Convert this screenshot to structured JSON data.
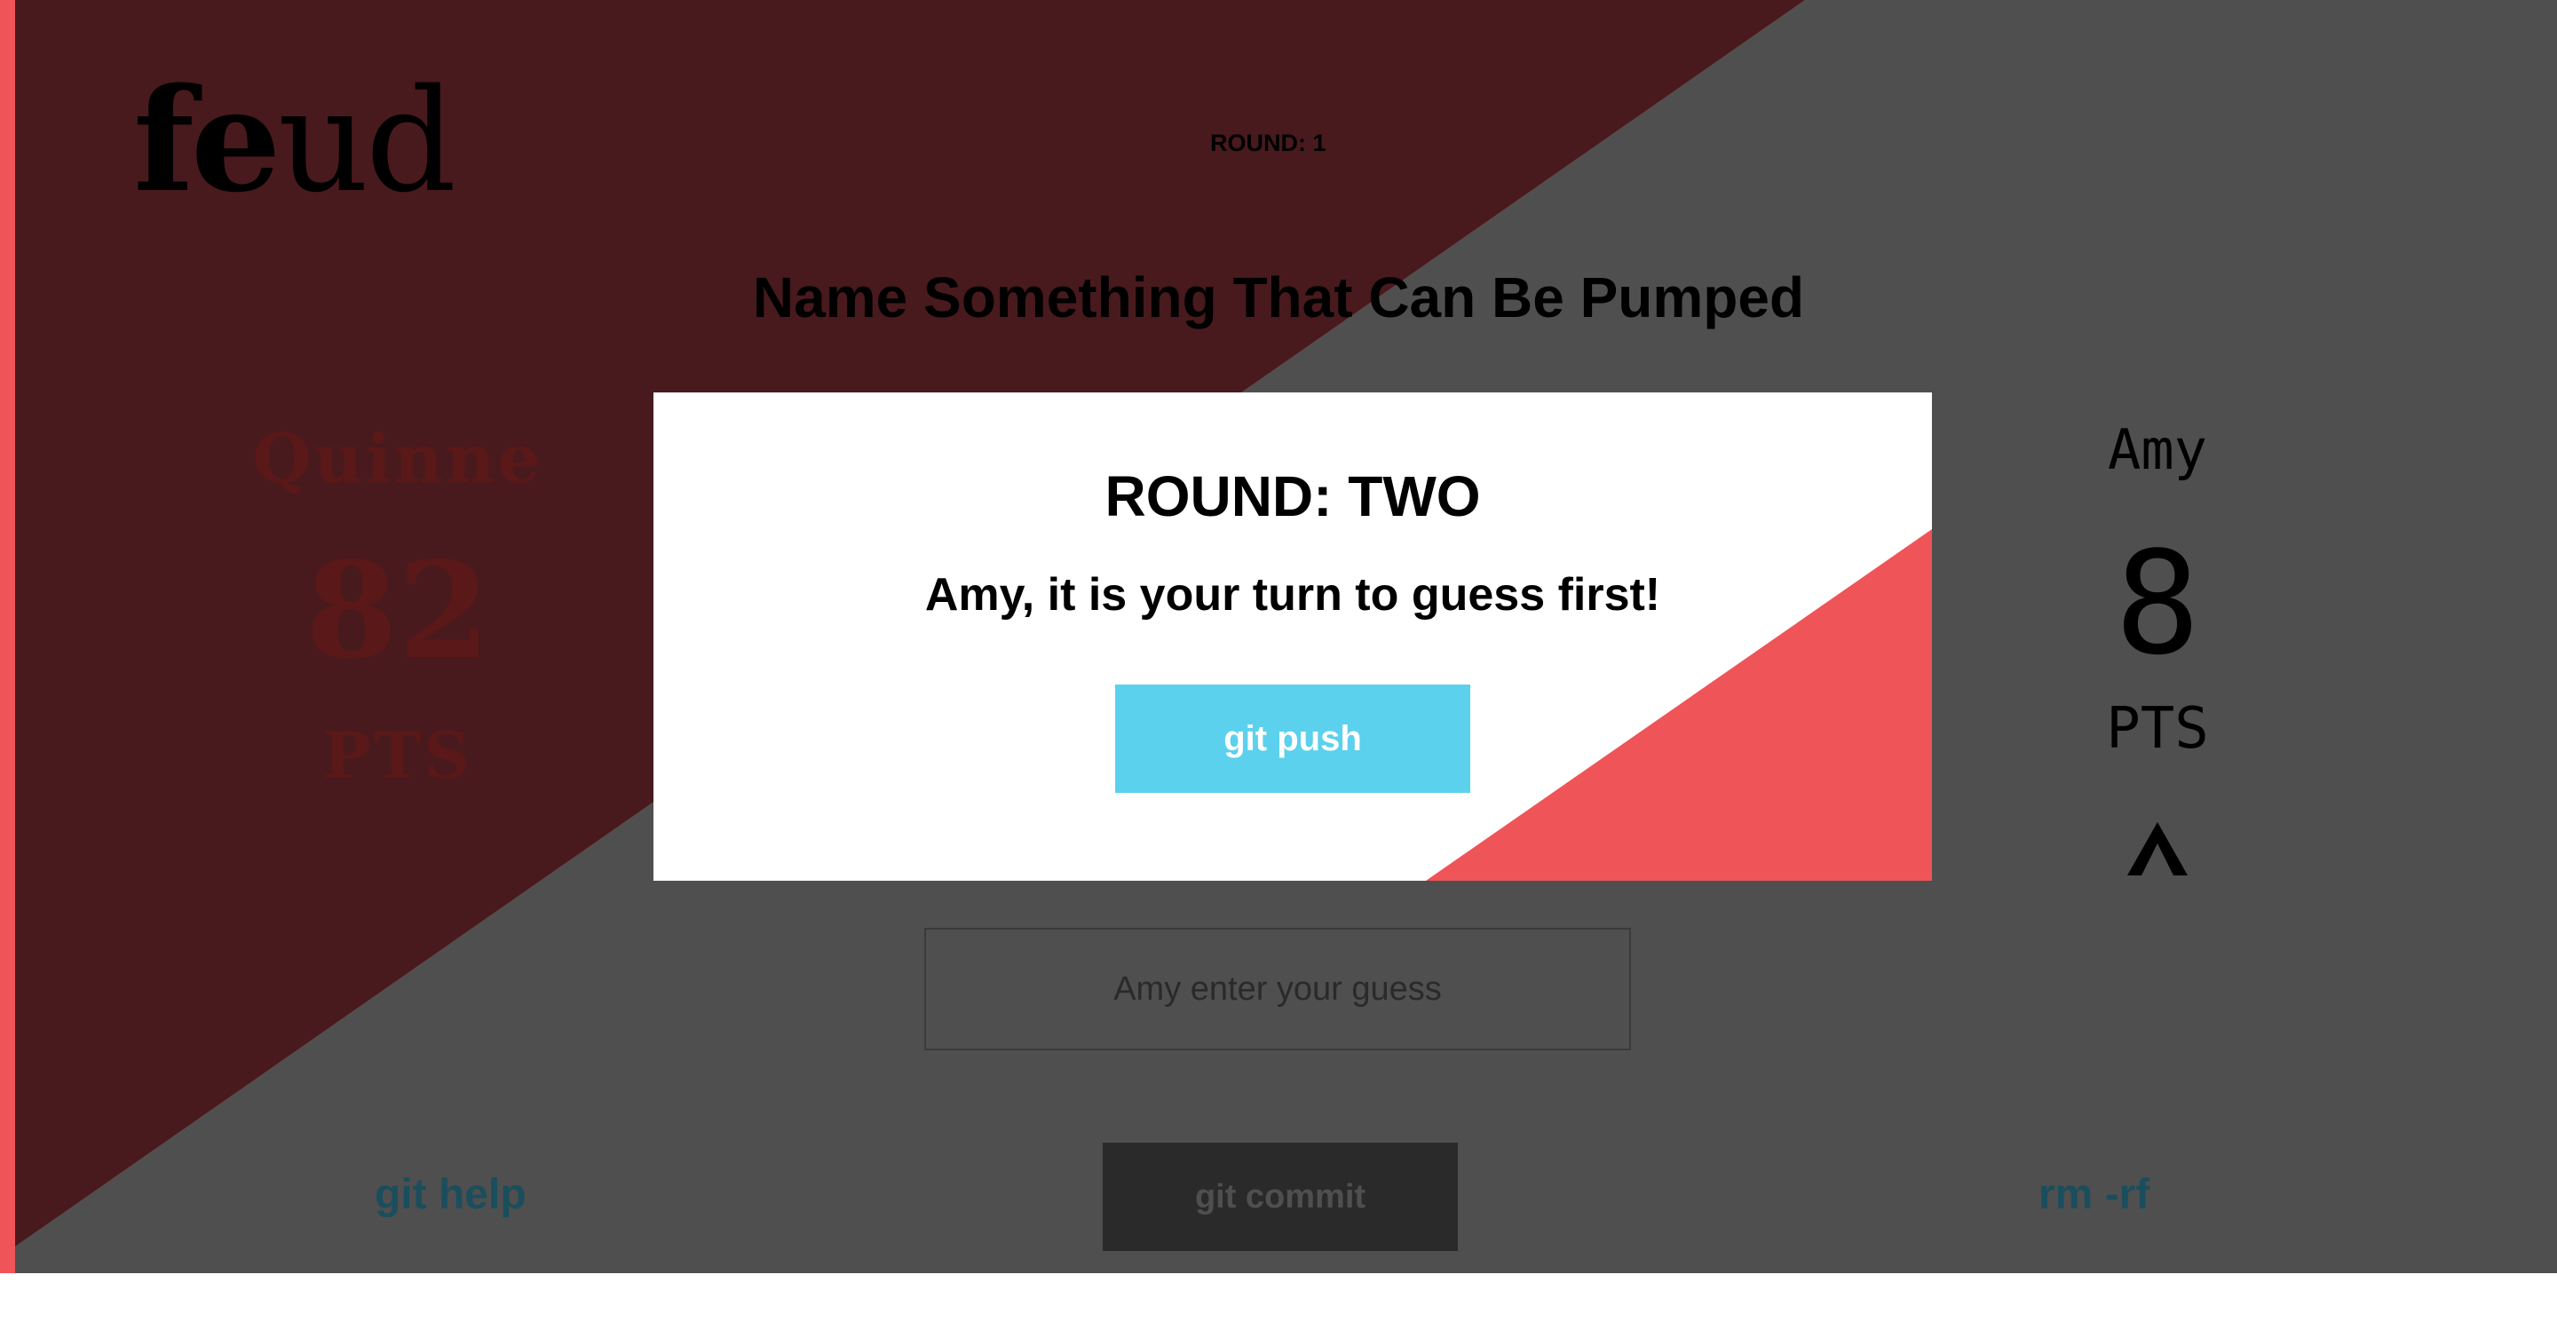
{
  "app": {
    "logo_part1": "fe",
    "logo_part2": "ud"
  },
  "header": {
    "round_label": "ROUND: 1",
    "question": "Name Something That Can Be Pumped"
  },
  "team_left": {
    "name": "Quinne",
    "score": "82",
    "pts_label": "PTS"
  },
  "team_right": {
    "name": "Amy",
    "score": "8",
    "pts_label": "PTS",
    "indicator_icon": "chevron-up-icon"
  },
  "guess": {
    "placeholder": "Amy enter your guess",
    "value": ""
  },
  "footer": {
    "help_label": "git help",
    "commit_label": "git commit",
    "reset_label": "rm -rf"
  },
  "modal": {
    "title": "ROUND: TWO",
    "message": "Amy, it is your turn to guess first!",
    "button_label": "git push"
  },
  "colors": {
    "accent_red": "#ef5459",
    "overlay_dark_red": "#481a1d",
    "overlay_gray": "#4f4f4f",
    "push_button": "#5bd1ee",
    "link_teal": "#1b4e5c"
  }
}
